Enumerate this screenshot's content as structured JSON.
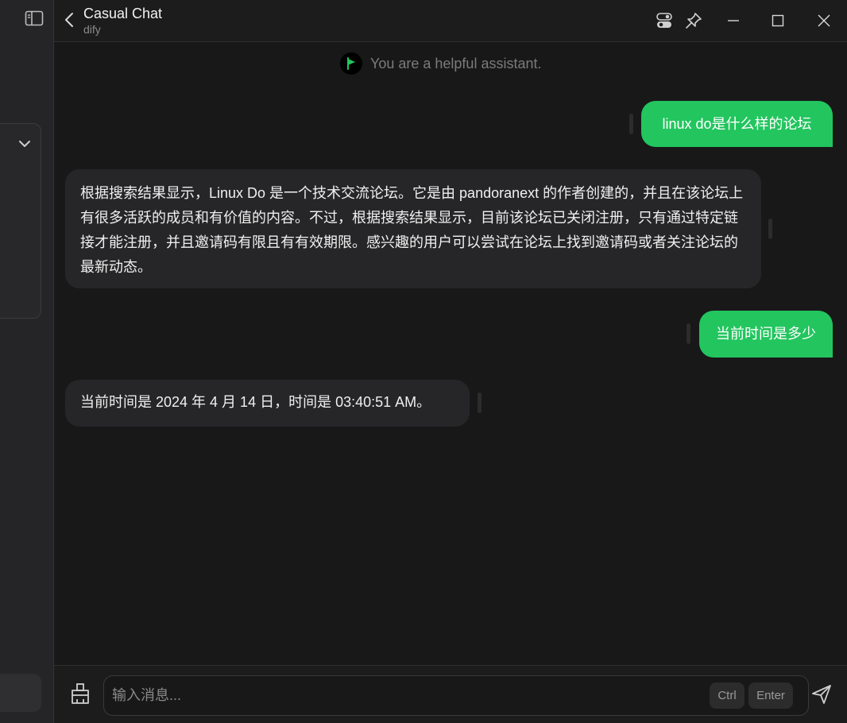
{
  "window": {
    "title": "Casual Chat",
    "subtitle": "dify"
  },
  "icons": {
    "sidebar_toggle": "sidebar-panel-icon",
    "back": "chevron-left-icon",
    "settings_toggle": "toggle-switch-icon",
    "pin": "pin-icon",
    "minimize": "minimize-icon",
    "maximize": "maximize-icon",
    "close": "close-icon",
    "expand": "chevron-down-icon",
    "clear": "broom-icon",
    "send": "send-icon"
  },
  "system_prompt": {
    "text": "You are a helpful assistant."
  },
  "messages": [
    {
      "role": "user",
      "text": "linux do是什么样的论坛"
    },
    {
      "role": "assistant",
      "text": "根据搜索结果显示，Linux Do 是一个技术交流论坛。它是由 pandoranext 的作者创建的，并且在该论坛上有很多活跃的成员和有价值的内容。不过，根据搜索结果显示，目前该论坛已关闭注册，只有通过特定链接才能注册，并且邀请码有限且有有效期限。感兴趣的用户可以尝试在论坛上找到邀请码或者关注论坛的最新动态。"
    },
    {
      "role": "user",
      "text": "当前时间是多少"
    },
    {
      "role": "assistant",
      "text": "当前时间是 2024 年 4 月 14 日，时间是 03:40:51 AM。"
    }
  ],
  "composer": {
    "placeholder": "输入消息...",
    "value": "",
    "shortcut_ctrl": "Ctrl",
    "shortcut_enter": "Enter"
  },
  "colors": {
    "accent": "#22c55e",
    "background": "#181818",
    "bubble_bot": "#262628"
  }
}
